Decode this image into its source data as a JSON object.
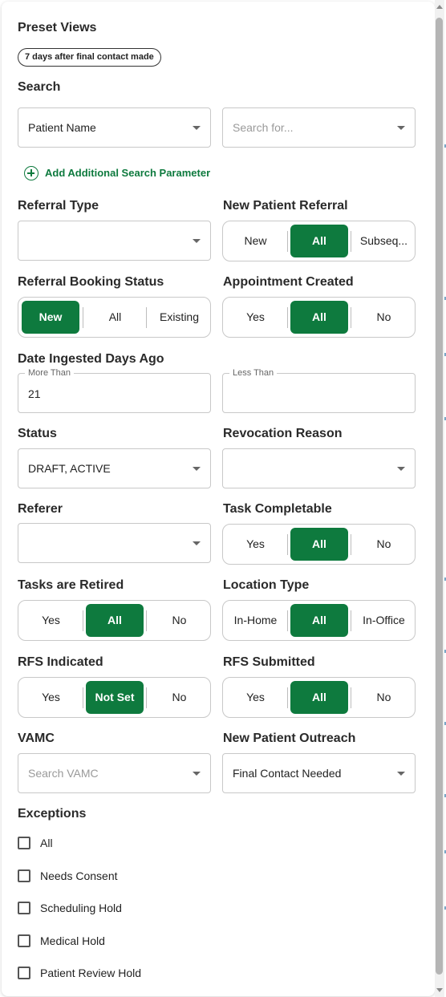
{
  "preset_views": {
    "title": "Preset Views",
    "chip": "7 days after final contact made"
  },
  "search": {
    "title": "Search",
    "field_value": "Patient Name",
    "search_placeholder": "Search for...",
    "add_param_label": "Add Additional Search Parameter"
  },
  "referral_type": {
    "label": "Referral Type",
    "value": ""
  },
  "new_patient_referral": {
    "label": "New Patient Referral",
    "options": [
      "New",
      "All",
      "Subseq..."
    ],
    "selected": "All"
  },
  "referral_booking_status": {
    "label": "Referral Booking Status",
    "options": [
      "New",
      "All",
      "Existing"
    ],
    "selected": "New"
  },
  "appointment_created": {
    "label": "Appointment Created",
    "options": [
      "Yes",
      "All",
      "No"
    ],
    "selected": "All"
  },
  "date_ingested": {
    "label": "Date Ingested Days Ago",
    "more_than_label": "More Than",
    "more_than_value": "21",
    "less_than_label": "Less Than",
    "less_than_value": ""
  },
  "status": {
    "label": "Status",
    "value": "DRAFT, ACTIVE"
  },
  "revocation_reason": {
    "label": "Revocation Reason",
    "value": ""
  },
  "referer": {
    "label": "Referer",
    "value": ""
  },
  "task_completable": {
    "label": "Task Completable",
    "options": [
      "Yes",
      "All",
      "No"
    ],
    "selected": "All"
  },
  "tasks_retired": {
    "label": "Tasks are Retired",
    "options": [
      "Yes",
      "All",
      "No"
    ],
    "selected": "All"
  },
  "location_type": {
    "label": "Location Type",
    "options": [
      "In-Home",
      "All",
      "In-Office"
    ],
    "selected": "All"
  },
  "rfs_indicated": {
    "label": "RFS Indicated",
    "options": [
      "Yes",
      "Not Set",
      "No"
    ],
    "selected": "Not Set"
  },
  "rfs_submitted": {
    "label": "RFS Submitted",
    "options": [
      "Yes",
      "All",
      "No"
    ],
    "selected": "All"
  },
  "vamc": {
    "label": "VAMC",
    "placeholder": "Search VAMC"
  },
  "new_patient_outreach": {
    "label": "New Patient Outreach",
    "value": "Final Contact Needed"
  },
  "exceptions": {
    "label": "Exceptions",
    "items": [
      "All",
      "Needs Consent",
      "Scheduling Hold",
      "Medical Hold",
      "Patient Review Hold"
    ]
  },
  "colors": {
    "accent": "#0e7a3e",
    "border": "#c8c8c8"
  }
}
